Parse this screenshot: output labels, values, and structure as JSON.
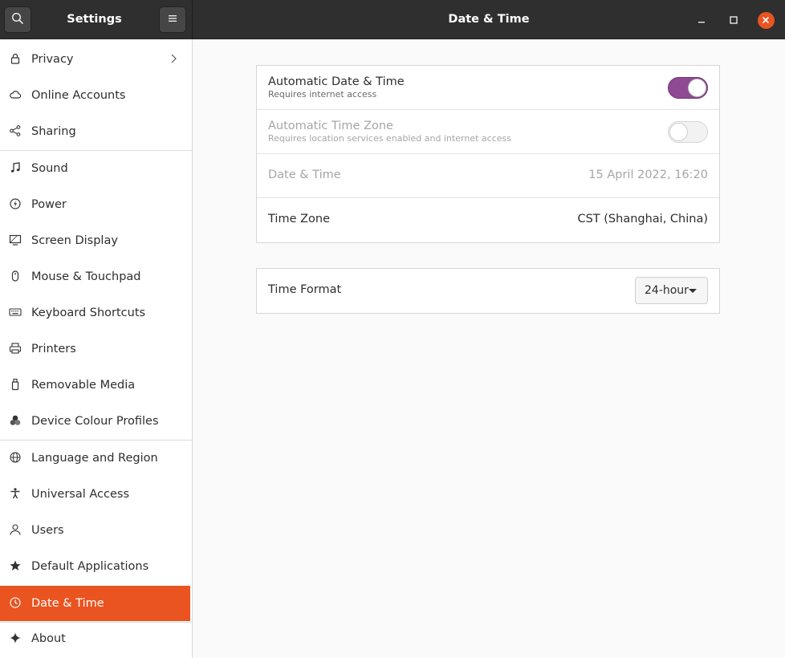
{
  "header": {
    "sidebar_title": "Settings",
    "panel_title": "Date & Time"
  },
  "sidebar": {
    "items": [
      {
        "label": "Privacy",
        "icon": "lock-icon"
      },
      {
        "label": "Online Accounts",
        "icon": "cloud-icon"
      },
      {
        "label": "Sharing",
        "icon": "share-icon"
      },
      {
        "label": "Sound",
        "icon": "music-note-icon"
      },
      {
        "label": "Power",
        "icon": "power-icon"
      },
      {
        "label": "Screen Display",
        "icon": "display-icon"
      },
      {
        "label": "Mouse & Touchpad",
        "icon": "mouse-icon"
      },
      {
        "label": "Keyboard Shortcuts",
        "icon": "keyboard-icon"
      },
      {
        "label": "Printers",
        "icon": "printer-icon"
      },
      {
        "label": "Removable Media",
        "icon": "usb-drive-icon"
      },
      {
        "label": "Device Colour Profiles",
        "icon": "color-profiles-icon"
      },
      {
        "label": "Language and Region",
        "icon": "globe-icon"
      },
      {
        "label": "Universal Access",
        "icon": "accessibility-icon"
      },
      {
        "label": "Users",
        "icon": "user-icon"
      },
      {
        "label": "Default Applications",
        "icon": "star-icon"
      },
      {
        "label": "Date & Time",
        "icon": "clock-icon"
      },
      {
        "label": "About",
        "icon": "sparkle-icon"
      }
    ],
    "active": "Date & Time"
  },
  "main": {
    "rows": {
      "auto_datetime": {
        "title": "Automatic Date & Time",
        "subtitle": "Requires internet access",
        "enabled": true
      },
      "auto_timezone": {
        "title": "Automatic Time Zone",
        "subtitle": "Requires location services enabled and internet access",
        "enabled": false
      },
      "datetime": {
        "title": "Date & Time",
        "value": "15 April 2022, 16:20"
      },
      "timezone": {
        "title": "Time Zone",
        "value": "CST (Shanghai, China)"
      },
      "time_format": {
        "title": "Time Format",
        "value": "24-hour"
      }
    }
  },
  "colors": {
    "accent": "#e95420",
    "toggle_on": "#8e4a93",
    "headerbar": "#2f2f2f"
  }
}
